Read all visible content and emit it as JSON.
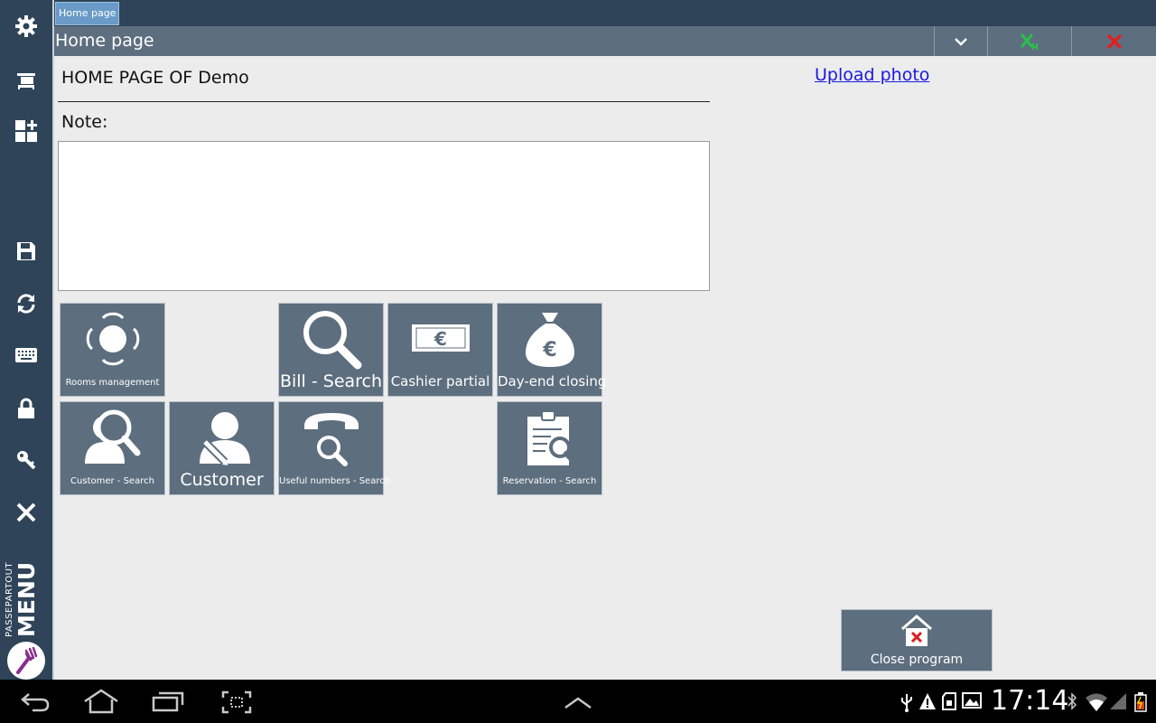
{
  "tabs": [
    {
      "label": "Home page"
    }
  ],
  "title": "Home page",
  "content": {
    "heading": "HOME PAGE OF Demo",
    "upload_link": "Upload photo",
    "note_label": "Note:",
    "note_value": ""
  },
  "tiles": {
    "rooms": "Rooms management",
    "bill_search": "Bill - Search",
    "cashier_partial": "Cashier partial",
    "day_end": "Day-end closing",
    "customer_search": "Customer - Search",
    "customer": "Customer",
    "useful_numbers": "Useful numbers - Search",
    "reservation_search": "Reservation - Search"
  },
  "close_program": "Close program",
  "brand": {
    "line1": "PASSEPARTOUT",
    "line2": "MENU"
  },
  "status_bar": {
    "time": "17:14"
  },
  "colors": {
    "sidebar": "#2f4458",
    "titlebar": "#5d6e7e",
    "tile": "#5d6e7e",
    "content_bg": "#ececec",
    "tab_active": "#6a9bc8",
    "confirm_green": "#27c04b",
    "cancel_red": "#e02020",
    "link": "#1a1ae0"
  },
  "icons": {
    "sidebar": [
      "gear-icon",
      "desk-icon",
      "dashboard-add-icon",
      "save-icon",
      "refresh-icon",
      "keyboard-icon",
      "lock-icon",
      "key-icon",
      "close-icon"
    ],
    "tiles": [
      "table-chairs-icon",
      "search-icon",
      "euro-banknote-icon",
      "money-bag-icon",
      "customer-search-icon",
      "customer-edit-icon",
      "phone-search-icon",
      "clipboard-search-icon"
    ],
    "navbar": [
      "back-icon",
      "home-icon",
      "recent-apps-icon",
      "screenshot-icon",
      "chevron-up-icon",
      "usb-icon",
      "warning-icon",
      "sd-card-icon",
      "gallery-icon",
      "bluetooth-icon",
      "wifi-icon",
      "signal-icon",
      "battery-icon"
    ]
  }
}
